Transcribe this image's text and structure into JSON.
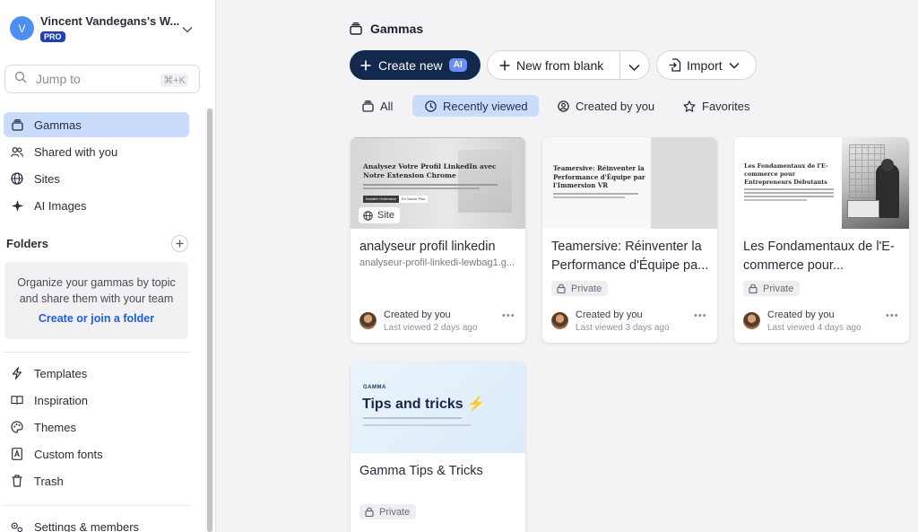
{
  "workspace": {
    "avatar_initial": "V",
    "name": "Vincent Vandegans's W...",
    "plan_badge": "PRO"
  },
  "search": {
    "placeholder": "Jump to",
    "shortcut": "⌘+K"
  },
  "nav": {
    "gammas": "Gammas",
    "shared": "Shared with you",
    "sites": "Sites",
    "ai_images": "AI Images"
  },
  "folders": {
    "heading": "Folders",
    "empty_text_line1": "Organize your gammas by topic",
    "empty_text_line2": "and share them with your team",
    "create_link": "Create or join a folder"
  },
  "bottom_nav": {
    "templates": "Templates",
    "inspiration": "Inspiration",
    "themes": "Themes",
    "custom_fonts": "Custom fonts",
    "trash": "Trash",
    "settings": "Settings & members"
  },
  "main": {
    "title": "Gammas",
    "create_new": "Create new",
    "ai_badge": "AI",
    "new_from_blank": "New from blank",
    "import": "Import",
    "tabs": {
      "all": "All",
      "recent": "Recently viewed",
      "created": "Created by you",
      "favorites": "Favorites"
    }
  },
  "cards": [
    {
      "thumb_title": "Analysez Votre Profil LinkedIn avec Notre Extension Chrome",
      "thumb_btn1": "Installer l'extension",
      "thumb_btn2": "En Savoir Plus",
      "site_badge": "Site",
      "title": "analyseur profil linkedin",
      "subtitle": "analyseur-profil-linkedi-lewbag1.g...",
      "created_by": "Created by you",
      "last_viewed": "Last viewed 2 days ago"
    },
    {
      "thumb_title": "Teamersive: Réinventer la Performance d'Équipe par l'Immersion VR",
      "title_line1": "Teamersive: Réinventer la",
      "title_line2": "Performance d'Équipe pa...",
      "privacy": "Private",
      "created_by": "Created by you",
      "last_viewed": "Last viewed 3 days ago"
    },
    {
      "thumb_title": "Les Fondamentaux de l'E-commerce pour Entrepreneurs Débutants",
      "title_line1": "Les Fondamentaux de l'E-",
      "title_line2": "commerce pour...",
      "privacy": "Private",
      "created_by": "Created by you",
      "last_viewed": "Last viewed 4 days ago"
    },
    {
      "thumb_brand": "GAMMA",
      "thumb_title": "Tips and tricks ⚡",
      "title": "Gamma Tips & Tricks",
      "privacy": "Private"
    }
  ],
  "colors": {
    "accent_dark": "#12284d",
    "active_bg": "#c9dcfb",
    "link": "#1d5fd8",
    "ai_badge": "#6b8ff7"
  }
}
